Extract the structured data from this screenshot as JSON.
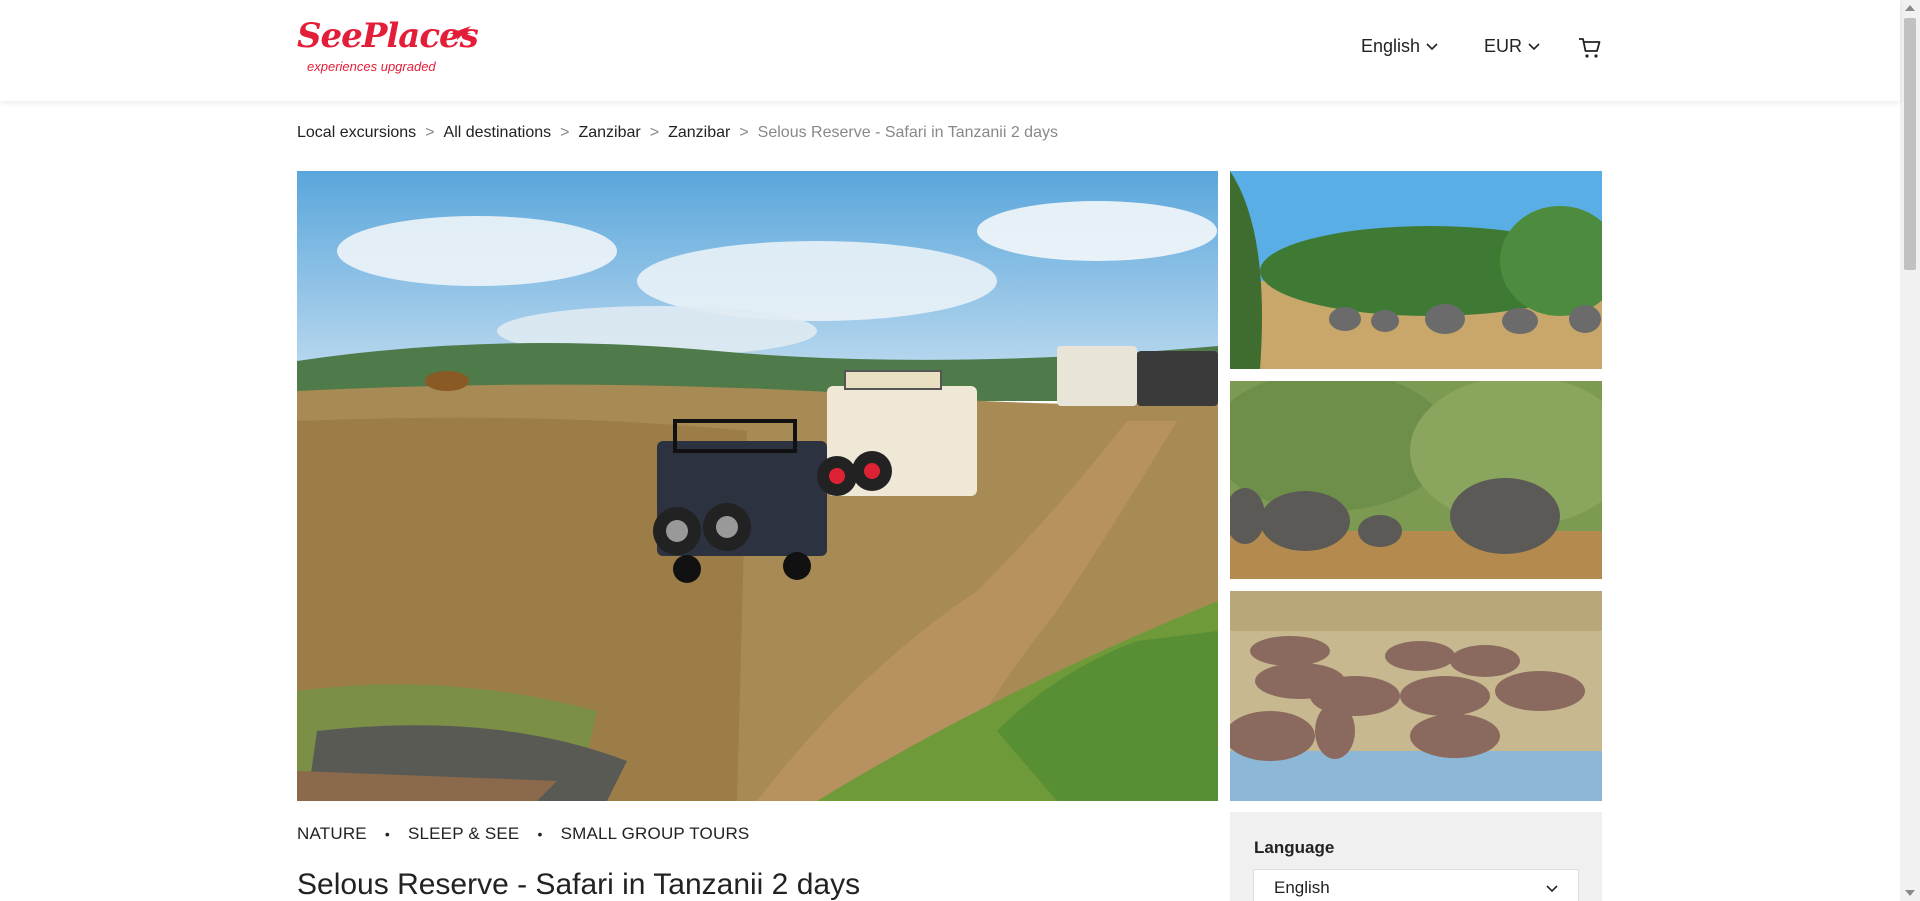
{
  "header": {
    "logo_text": "SeePlaces",
    "logo_tagline": "experiences upgraded",
    "language_label": "English",
    "currency_label": "EUR",
    "cart_icon": "cart-icon"
  },
  "breadcrumb": {
    "items": [
      "Local excursions",
      "All destinations",
      "Zanzibar",
      "Zanzibar"
    ],
    "current": "Selous Reserve - Safari in Tanzanii 2 days",
    "separator": ">"
  },
  "gallery": {
    "main_image": "safari-jeeps-lion",
    "thumbnails": [
      "elephants-palms",
      "elephant-herd-trees",
      "hippos-water"
    ]
  },
  "tags": [
    "NATURE",
    "SLEEP & SEE",
    "SMALL GROUP TOURS"
  ],
  "tag_separator": "•",
  "title": "Selous Reserve - Safari in Tanzanii 2 days",
  "booking": {
    "language_label": "Language",
    "language_value": "English"
  },
  "colors": {
    "brand": "#e31e38",
    "panel_bg": "#f0f0f0"
  }
}
